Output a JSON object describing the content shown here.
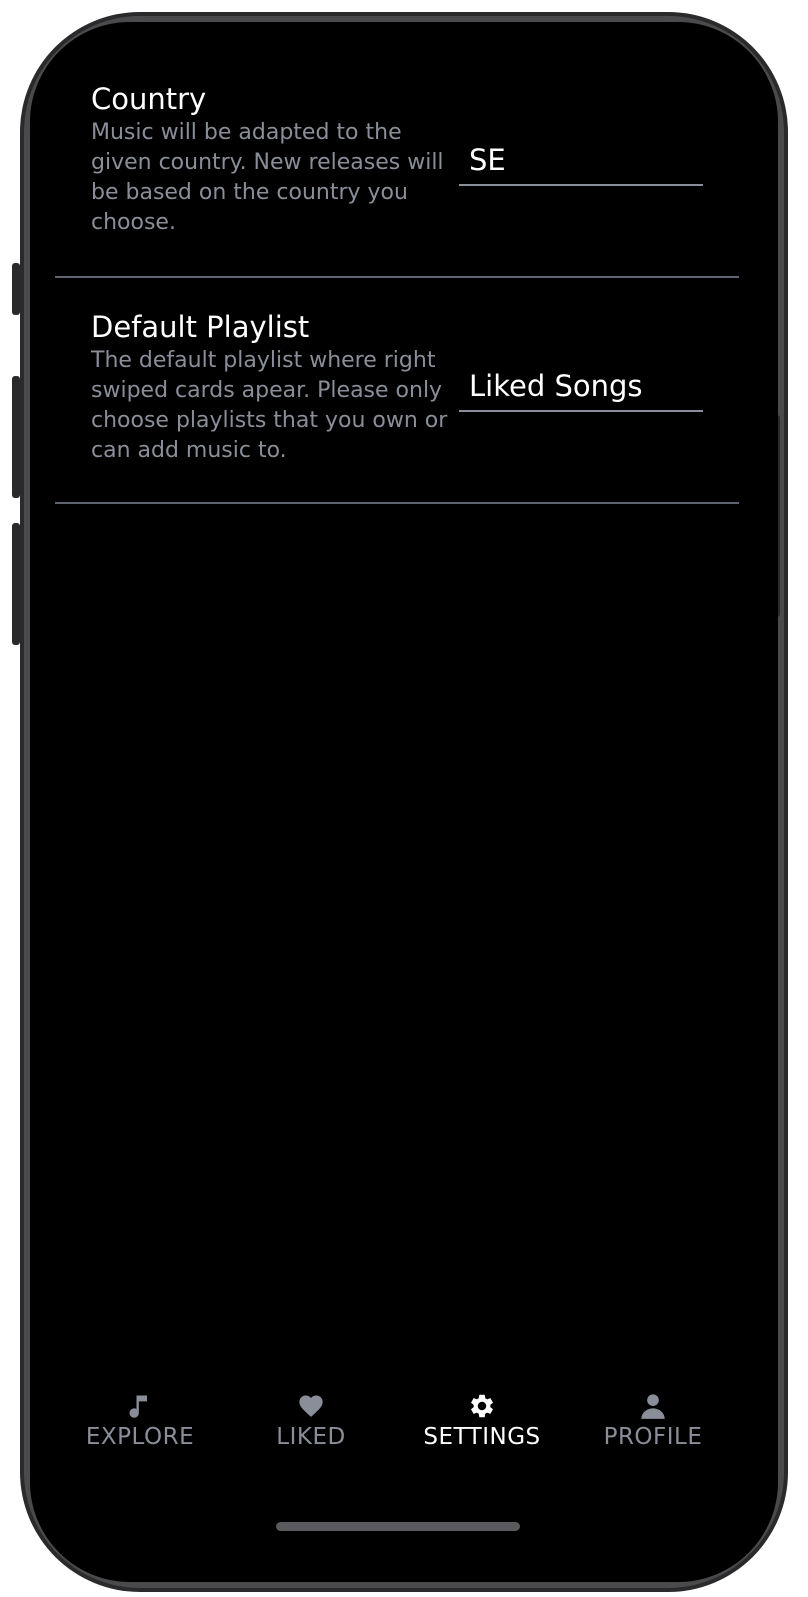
{
  "settings": {
    "country": {
      "title": "Country",
      "description": "Music will be adapted to the given country. New releases will be based on the country you choose.",
      "value": "SE"
    },
    "default_playlist": {
      "title": "Default Playlist",
      "description": "The default playlist where right swiped cards apear. Please only choose playlists that you own or can add music to.",
      "value": "Liked Songs"
    }
  },
  "tabbar": {
    "explore": {
      "label": "EXPLORE",
      "icon": "music-note-icon"
    },
    "liked": {
      "label": "LIKED",
      "icon": "heart-icon"
    },
    "settings": {
      "label": "SETTINGS",
      "icon": "gear-icon"
    },
    "profile": {
      "label": "PROFILE",
      "icon": "person-icon"
    },
    "active": "settings"
  },
  "colors": {
    "background": "#000000",
    "text_primary": "#ffffff",
    "text_secondary": "#8a8e99",
    "divider": "#5f6470"
  }
}
